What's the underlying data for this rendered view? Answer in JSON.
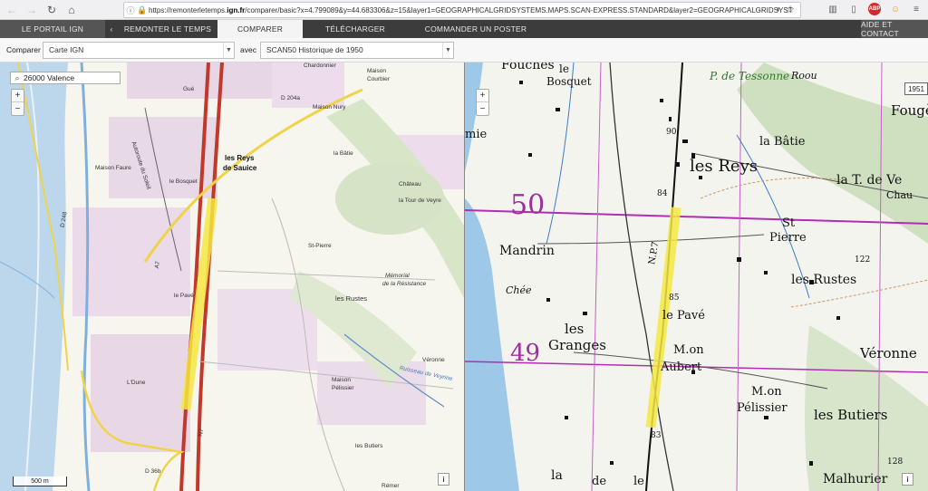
{
  "browser": {
    "url_prefix": "https://remonterletemps.",
    "url_domain": "ign.fr",
    "url_suffix": "/comparer/basic?x=4.799089&y=44.683306&z=15&layer1=GEOGRAPHICALGRIDSYSTEMS.MAPS.SCAN-EXPRESS.STANDARD&layer2=GEOGRAPHICALGRIDSYST",
    "more": "···"
  },
  "nav": {
    "portal": "LE PORTAIL IGN",
    "back": "‹",
    "remonter": "REMONTER LE TEMPS",
    "comparer": "COMPARER",
    "telecharger": "TÉLÉCHARGER",
    "commander": "COMMANDER UN POSTER",
    "aide": "AIDE ET CONTACT"
  },
  "compare": {
    "label": "Comparer",
    "left_layer": "Carte IGN",
    "avec": "avec",
    "right_layer": "SCAN50 Historique de 1950"
  },
  "search": {
    "value": "26000 Valence"
  },
  "zoom": {
    "in": "+",
    "out": "−"
  },
  "scale": "500 m",
  "info": "i",
  "year_badge": "1951",
  "left_map_labels": {
    "chardonnier": "Chardonnier",
    "maison_courbier": "Maison\nCourbier",
    "d204a": "D 204a",
    "maison_nury": "Maison Nury",
    "gue": "Gué",
    "les_reys": "les Reys",
    "de_sauice": "de Sauice",
    "la_batie": "la Bâtie",
    "chateau": "Château",
    "tour_veyne": "la Tour de Veyre",
    "maison_faure": "Maison Faure",
    "le_bosquet": "le Bosquet",
    "st_pierre": "St-Pierre",
    "memorial": "Mémorial",
    "resistance": "de la Résistance",
    "le_pave": "le Pavé",
    "les_rustes": "les Rustes",
    "veronne": "Véronne",
    "maison_pelissier": "Maison\nPélissier",
    "les_butiers": "les Butiers",
    "d248": "D 248",
    "a7": "A7",
    "autoroute": "Autoroute du Soleil",
    "n7": "N7",
    "d36b": "D 36b",
    "la_dune": "L'Dune",
    "remer": "Rémer",
    "ruisseau": "Ruisseau de Veyrine"
  },
  "right_map_labels": {
    "fouches": "Fouches",
    "le_bosquet": "le\nBosquet",
    "p_de_tessonne": "P. de Tessonne",
    "roou": "Roou",
    "fougere": "Fougè",
    "la_batie": "la Bâtie",
    "les_reys": "les Reys",
    "mie": "mie",
    "la_t_de_ve": "la T. de Ve",
    "chau": "Chau",
    "st_pierre": "St\nPierre",
    "mandrin": "Mandrin",
    "chee": "Chée",
    "les_rustes": "les Rustes",
    "les_granges": "les\nGranges",
    "le_pave": "le Pavé",
    "m_aubert": "M.on\nAubert",
    "veronne": "Véronne",
    "m_pelissier": "M.on\nPélissier",
    "les_butiers": "les Butiers",
    "n50": "50",
    "n49": "49",
    "np7": "N.P.7",
    "n84": "84",
    "n90": "90",
    "n85": "85",
    "n83": "83",
    "n122": "122",
    "n128": "128",
    "malhurier": "Malhurier",
    "la": "la",
    "de": "de",
    "le": "le"
  }
}
